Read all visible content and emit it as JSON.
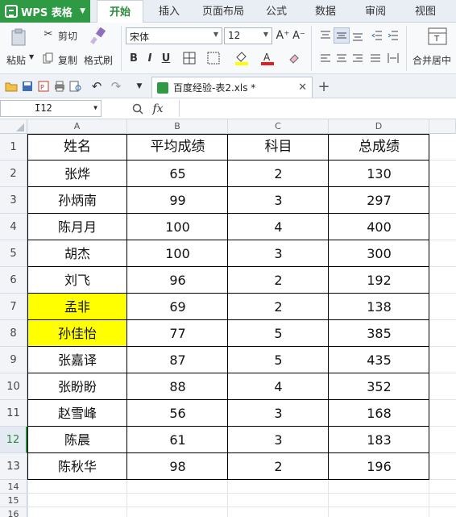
{
  "app": {
    "logo_label": "WPS 表格"
  },
  "menu": {
    "tabs": [
      "开始",
      "插入",
      "页面布局",
      "公式",
      "数据",
      "审阅",
      "视图"
    ]
  },
  "ribbon": {
    "paste": "粘贴",
    "cut": "剪切",
    "copy": "复制",
    "format_painter": "格式刷",
    "font_name": "宋体",
    "font_size": "12",
    "bold": "B",
    "italic": "I",
    "underline": "U",
    "merge_center": "合并居中",
    "grow_font": "A⁺",
    "shrink_font": "A⁻"
  },
  "document": {
    "tab_title": "百度经验-表2.xls *"
  },
  "formula_bar": {
    "cell_ref": "I12",
    "fx": "fx"
  },
  "sheet": {
    "columns": [
      "A",
      "B",
      "C",
      "D"
    ],
    "rows": [
      {
        "num": "1",
        "cells": [
          "姓名",
          "平均成绩",
          "科目",
          "总成绩"
        ]
      },
      {
        "num": "2",
        "cells": [
          "张烨",
          "65",
          "2",
          "130"
        ]
      },
      {
        "num": "3",
        "cells": [
          "孙炳南",
          "99",
          "3",
          "297"
        ]
      },
      {
        "num": "4",
        "cells": [
          "陈月月",
          "100",
          "4",
          "400"
        ]
      },
      {
        "num": "5",
        "cells": [
          "胡杰",
          "100",
          "3",
          "300"
        ]
      },
      {
        "num": "6",
        "cells": [
          "刘飞",
          "96",
          "2",
          "192"
        ]
      },
      {
        "num": "7",
        "cells": [
          "孟非",
          "69",
          "2",
          "138"
        ]
      },
      {
        "num": "8",
        "cells": [
          "孙佳怡",
          "77",
          "5",
          "385"
        ]
      },
      {
        "num": "9",
        "cells": [
          "张嘉译",
          "87",
          "5",
          "435"
        ]
      },
      {
        "num": "10",
        "cells": [
          "张盼盼",
          "88",
          "4",
          "352"
        ]
      },
      {
        "num": "11",
        "cells": [
          "赵雪峰",
          "56",
          "3",
          "168"
        ]
      },
      {
        "num": "12",
        "cells": [
          "陈晨",
          "61",
          "3",
          "183"
        ]
      },
      {
        "num": "13",
        "cells": [
          "陈秋华",
          "98",
          "2",
          "196"
        ]
      },
      {
        "num": "14",
        "cells": [
          "",
          "",
          "",
          ""
        ]
      },
      {
        "num": "15",
        "cells": [
          "",
          "",
          "",
          ""
        ]
      },
      {
        "num": "16",
        "cells": [
          "",
          "",
          "",
          ""
        ]
      }
    ],
    "highlight_color": "#ffff00",
    "highlighted_rows": [
      "7",
      "8"
    ],
    "active_row": "12"
  }
}
